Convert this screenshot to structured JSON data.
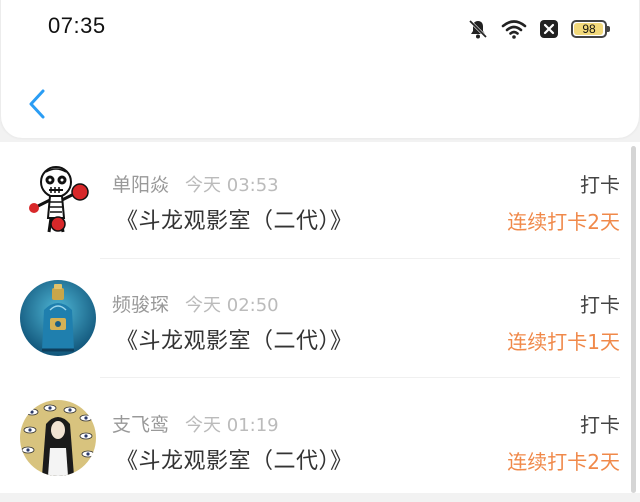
{
  "status_bar": {
    "time": "07:35",
    "icons": [
      "mute-bell-icon",
      "wifi-icon",
      "no-sim-icon",
      "battery-icon"
    ],
    "battery_level": "98",
    "battery_fill_percent": 98,
    "battery_color": "#f2d97b"
  },
  "nav": {
    "back_icon": "chevron-left-icon",
    "accent_color": "#2a9df4"
  },
  "checkins": [
    {
      "name": "单阳焱",
      "time": "今天 03:53",
      "title": "《斗龙观影室（二代）》",
      "action": "打卡",
      "streak": "连续打卡2天",
      "avatar": "skull-boxer-avatar"
    },
    {
      "name": "频骏琛",
      "time": "今天 02:50",
      "title": "《斗龙观影室（二代）》",
      "action": "打卡",
      "streak": "连续打卡1天",
      "avatar": "perfume-bottle-avatar"
    },
    {
      "name": "支飞鸾",
      "time": "今天 01:19",
      "title": "《斗龙观影室（二代）》",
      "action": "打卡",
      "streak": "连续打卡2天",
      "avatar": "eyes-girl-avatar"
    }
  ],
  "colors": {
    "streak": "#f0894a",
    "muted": "#999999",
    "title": "#333333"
  }
}
